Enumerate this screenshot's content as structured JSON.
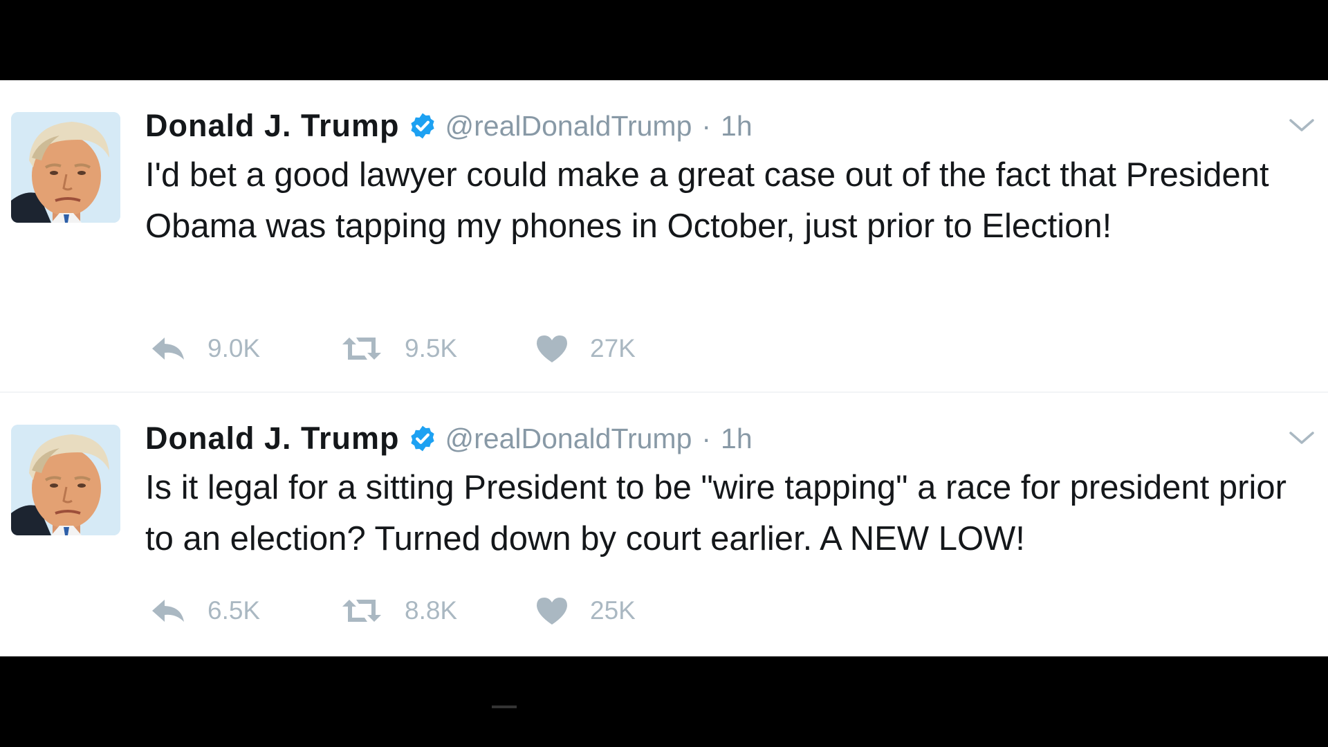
{
  "tweets": [
    {
      "name": "Donald J. Trump",
      "handle": "@realDonaldTrump",
      "separator": "·",
      "time": "1h",
      "text": "I'd bet a good lawyer could make a great case out of the fact that President Obama was tapping my phones in October, just prior to Election!",
      "replies": "9.0K",
      "retweets": "9.5K",
      "likes": "27K"
    },
    {
      "name": "Donald J. Trump",
      "handle": "@realDonaldTrump",
      "separator": "·",
      "time": "1h",
      "text": "Is it legal for a sitting President to be \"wire tapping\" a race for president prior to an election? Turned down by court earlier. A NEW LOW!",
      "replies": "6.5K",
      "retweets": "8.8K",
      "likes": "25K"
    }
  ],
  "icons": {
    "verified": "verified-badge-icon",
    "reply": "reply-icon",
    "retweet": "retweet-icon",
    "like": "heart-icon",
    "menu": "chevron-down-icon"
  },
  "colors": {
    "verified": "#1da1f2",
    "name": "#14171a",
    "meta": "#8899a6",
    "action": "#aab8c2"
  }
}
